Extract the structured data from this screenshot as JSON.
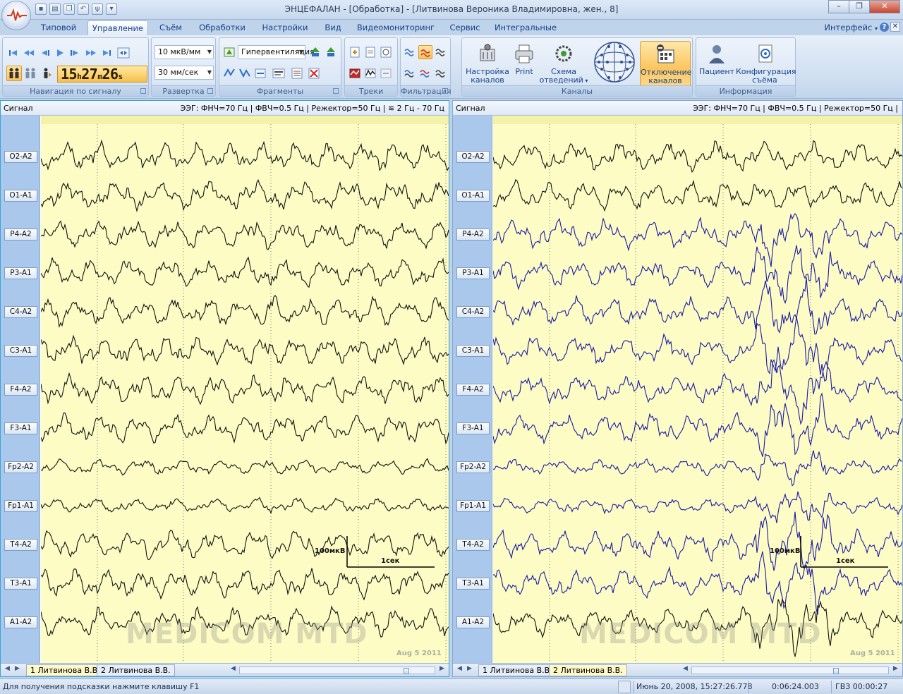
{
  "window": {
    "title": "ЭНЦЕФАЛАН - [Обработка] - [Литвинова Вероника Владимировна, жен., 8]"
  },
  "tabs": [
    "Типовой",
    "Управление",
    "Съём",
    "Обработки",
    "Настройки",
    "Вид",
    "Видеомониторинг",
    "Сервис",
    "Интегральные"
  ],
  "interface_menu": "Интерфейс",
  "help_label": "?",
  "ribbon": {
    "nav": {
      "label": "Навигация по сигналу",
      "clock_h": "15",
      "clock_h_unit": "h",
      "clock_m": "27",
      "clock_m_unit": "m",
      "clock_s": "26",
      "clock_s_unit": "s"
    },
    "sweep": {
      "label": "Развертка",
      "sensitivity": "10 мкВ/мм",
      "speed": "30 мм/сек"
    },
    "fragments": {
      "label": "Фрагменты",
      "type": "Гипервентиляция"
    },
    "tracks": {
      "label": "Треки"
    },
    "filter": {
      "label": "Фильтрация"
    },
    "channels": {
      "label": "Каналы",
      "setup_1": "Настройка",
      "setup_2": "каналов",
      "print": "Print",
      "scheme_1": "Схема",
      "scheme_2": "отведений",
      "disable_1": "Отключение",
      "disable_2": "каналов"
    },
    "info": {
      "label": "Информация",
      "patient": "Пациент",
      "config_1": "Конфигурация",
      "config_2": "съёма"
    }
  },
  "left_panel": {
    "signal_label": "Сигнал",
    "filters_text": "ЭЭГ: ФНЧ=70 Гц | ФВЧ=0.5 Гц | Режектор=50 Гц |",
    "band_text": "2 Гц - 70 Гц",
    "calib_amp": "100мкВ",
    "calib_time": "1сек",
    "watermark": "MEDICOM MTD",
    "date": "Aug  5 2011",
    "tabs": [
      "1 Литвинова В.В.",
      "2 Литвинова В.В."
    ]
  },
  "right_panel": {
    "signal_label": "Сигнал",
    "filters_text": "ЭЭГ: ФНЧ=70 Гц | ФВЧ=0.5 Гц | Режектор=50 Гц |",
    "calib_amp": "100мкВ",
    "calib_time": "1сек",
    "watermark": "MEDICOM MTD",
    "date": "Aug  5 2011",
    "tabs": [
      "1 Литвинова В.В.",
      "2 Литвинова В.В."
    ]
  },
  "channels": [
    "O2-A2",
    "O1-A1",
    "P4-A2",
    "P3-A1",
    "C4-A2",
    "C3-A1",
    "F4-A2",
    "F3-A1",
    "Fp2-A2",
    "Fp1-A1",
    "T4-A2",
    "T3-A1",
    "A1-A2"
  ],
  "status": {
    "hint": "Для получения подсказки нажмите клавишу F1",
    "datetime": "Июнь 20, 2008, 15:27:26.778",
    "duration": "0:06:24.003",
    "gvz": "ГВЗ 00:00:27"
  },
  "colors": {
    "plot_bg": "#fdfcc4",
    "trace_black": "#111111",
    "trace_blue": "#1a1aa8",
    "channel_column": "#a9c8ec",
    "ribbon_pressed": "#fbc25a"
  }
}
